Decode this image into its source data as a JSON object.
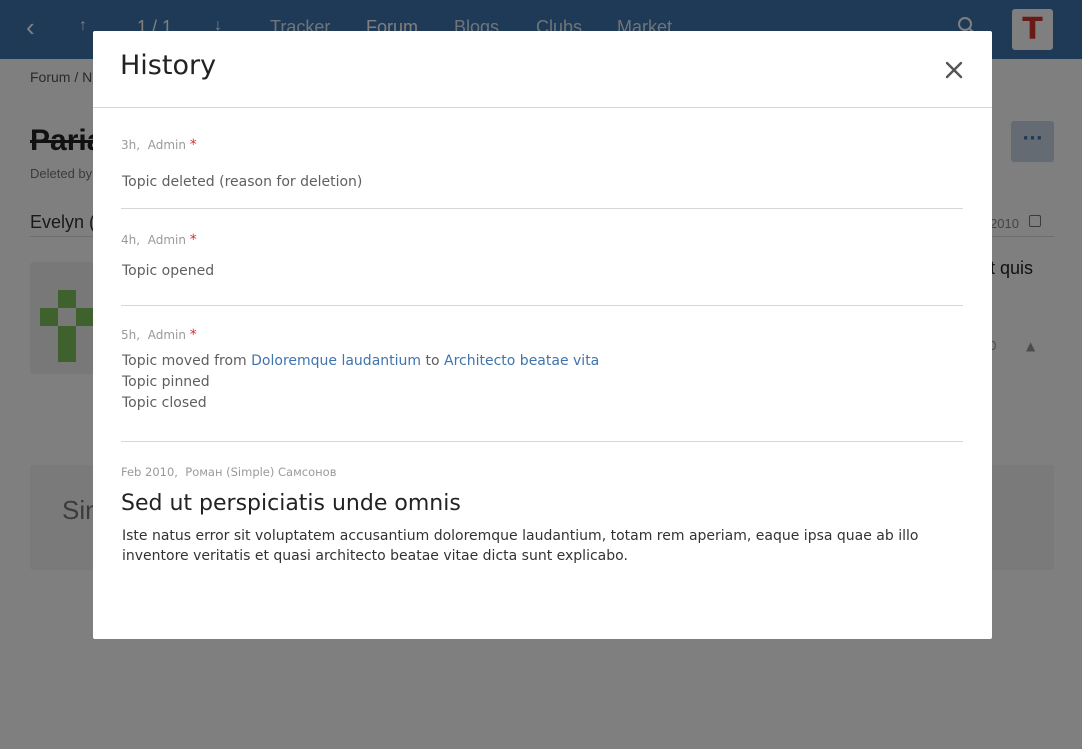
{
  "topbar": {
    "pager": "1 / 1",
    "nav": [
      "Tracker",
      "Forum",
      "Blogs",
      "Clubs",
      "Market"
    ],
    "active_nav": "Forum",
    "logo_letter": "T",
    "accent_color": "#3f74ae"
  },
  "page": {
    "breadcrumb": "Forum  /  N",
    "title": "Paria",
    "deleted_by": "Deleted by",
    "more_label": "···",
    "author": "Evelyn (",
    "post_date": "2010",
    "post_snippet": "t quis",
    "similar_label": "Sin"
  },
  "modal": {
    "title": "History",
    "close_icon": "close-icon",
    "entries": [
      {
        "time": "3h",
        "user": "Admin",
        "marker": "*",
        "changes": [
          "Topic deleted (reason for deletion)"
        ]
      },
      {
        "time": "4h",
        "user": "Admin",
        "marker": "*",
        "changes": [
          "Topic opened"
        ]
      },
      {
        "time": "5h",
        "user": "Admin",
        "marker": "*",
        "move": {
          "prefix": "Topic moved from",
          "from": "Doloremque laudantium",
          "joiner": "to",
          "to": "Architecto beatae vita"
        },
        "changes": [
          "Topic pinned",
          "Topic closed"
        ]
      }
    ],
    "post": {
      "time": "Feb 2010",
      "user": "Роман (Simple) Самсонов",
      "title": "Sed ut perspiciatis unde omnis",
      "body": "Iste natus error sit voluptatem accusantium doloremque laudantium, totam rem aperiam, eaque ipsa quae ab illo inventore veritatis et quasi architecto beatae vitae dicta sunt explicabo."
    }
  }
}
